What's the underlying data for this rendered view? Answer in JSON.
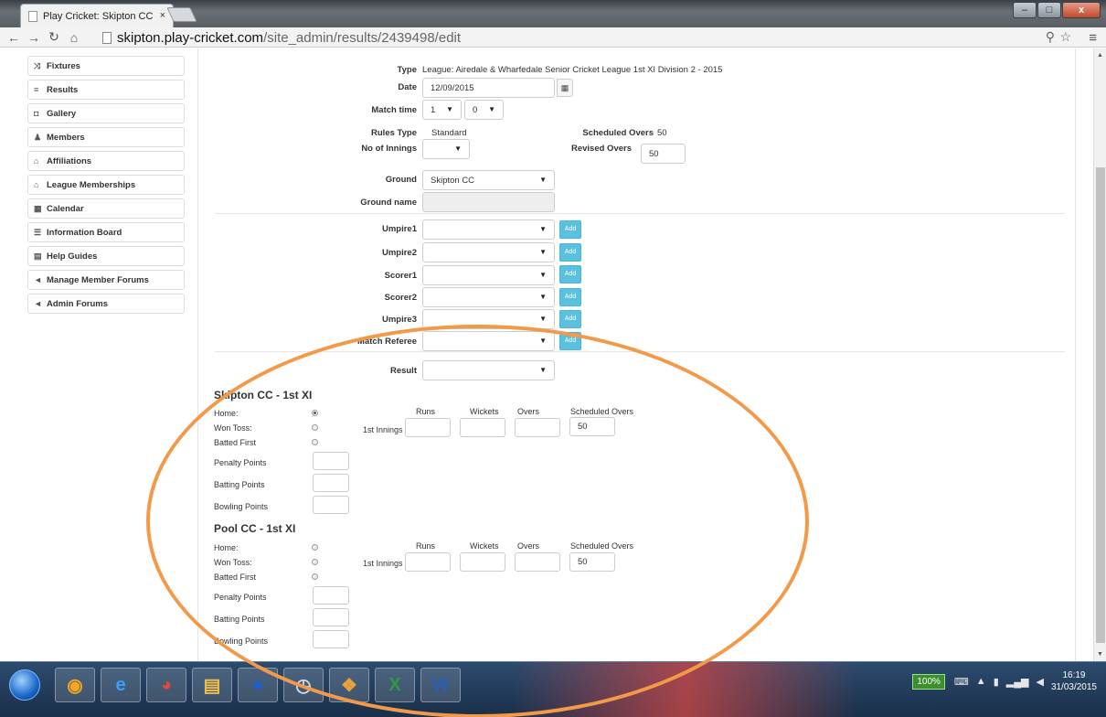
{
  "browser": {
    "tab_title": "Play Cricket: Skipton CC",
    "tab_close": "×",
    "url_host": "skipton.play-cricket.com",
    "url_path": "/site_admin/results/2439498/edit",
    "window_buttons": [
      "–",
      "□",
      "x"
    ]
  },
  "sidebar": {
    "items": [
      {
        "icon": "⤨",
        "label": "Fixtures"
      },
      {
        "icon": "≡",
        "label": "Results"
      },
      {
        "icon": "◘",
        "label": "Gallery"
      },
      {
        "icon": "♟",
        "label": "Members"
      },
      {
        "icon": "⌂",
        "label": "Affiliations"
      },
      {
        "icon": "⌂",
        "label": "League Memberships"
      },
      {
        "icon": "▦",
        "label": "Calendar"
      },
      {
        "icon": "☰",
        "label": "Information Board"
      },
      {
        "icon": "▤",
        "label": "Help Guides"
      },
      {
        "icon": "◄",
        "label": "Manage Member Forums"
      },
      {
        "icon": "◄",
        "label": "Admin Forums"
      }
    ]
  },
  "form": {
    "type_label": "Type",
    "type_value": "League: Airedale & Wharfedale Senior Cricket League 1st XI Division 2 - 2015",
    "date_label": "Date",
    "date_value": "12/09/2015",
    "match_time_label": "Match time",
    "match_hour": "1",
    "match_minute": "0",
    "rules_type_label": "Rules Type",
    "rules_type_value": "Standard",
    "scheduled_overs_label": "Scheduled Overs",
    "scheduled_overs_value": "50",
    "innings_label": "No of Innings",
    "innings_value": "",
    "revised_overs_label": "Revised Overs",
    "revised_overs_value": "50",
    "ground_label": "Ground",
    "ground_value": "Skipton CC",
    "ground_name_label": "Ground name",
    "officials": [
      {
        "label": "Umpire1",
        "value": ""
      },
      {
        "label": "Umpire2",
        "value": ""
      },
      {
        "label": "Scorer1",
        "value": ""
      },
      {
        "label": "Scorer2",
        "value": ""
      },
      {
        "label": "Umpire3",
        "value": ""
      },
      {
        "label": "Match Referee",
        "value": ""
      }
    ],
    "add_label": "Add",
    "result_label": "Result",
    "result_value": ""
  },
  "teams": [
    {
      "name": "Skipton CC - 1st XI",
      "home_label": "Home:",
      "won_toss_label": "Won Toss:",
      "batted_first_label": "Batted First",
      "home_checked": true,
      "innings_label": "1st Innings",
      "runs_label": "Runs",
      "wickets_label": "Wickets",
      "overs_label": "Overs",
      "scheduled_overs_label": "Scheduled Overs",
      "scheduled_overs_value": "50",
      "penalty_label": "Penalty Points",
      "batting_label": "Batting Points",
      "bowling_label": "Bowling Points"
    },
    {
      "name": "Pool CC - 1st XI",
      "home_label": "Home:",
      "won_toss_label": "Won Toss:",
      "batted_first_label": "Batted First",
      "home_checked": false,
      "innings_label": "1st Innings",
      "runs_label": "Runs",
      "wickets_label": "Wickets",
      "overs_label": "Overs",
      "scheduled_overs_label": "Scheduled Overs",
      "scheduled_overs_value": "50",
      "penalty_label": "Penalty Points",
      "batting_label": "Batting Points",
      "bowling_label": "Bowling Points"
    }
  ],
  "taskbar": {
    "battery": "100%",
    "time": "16:19",
    "date": "31/03/2015"
  },
  "colors": {
    "accent": "#5bc0de",
    "annotation": "#f39a4a"
  }
}
